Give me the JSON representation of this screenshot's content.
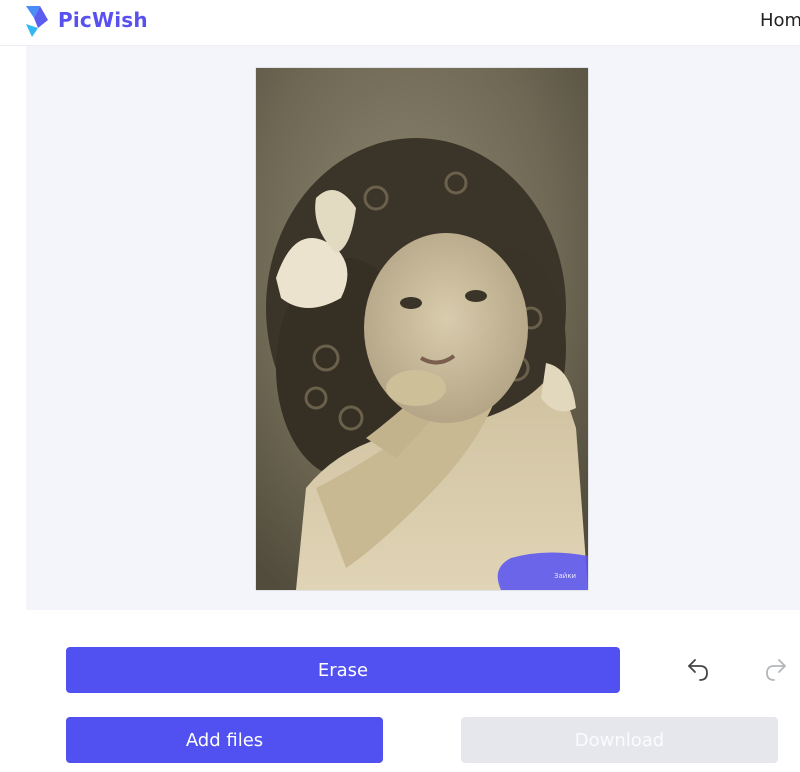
{
  "header": {
    "brand": "PicWish",
    "nav_home": "Home"
  },
  "canvas": {
    "watermark_text": "Зайки"
  },
  "actions": {
    "erase_label": "Erase",
    "add_files_label": "Add files",
    "download_label": "Download",
    "undo_icon": "undo-icon",
    "redo_icon": "redo-icon"
  },
  "colors": {
    "brand": "#5851f0",
    "primary_button": "#5151f2",
    "disabled_button": "#e6e7ec",
    "canvas_bg": "#f3f5fa",
    "brush_highlight": "#5a55f0"
  }
}
